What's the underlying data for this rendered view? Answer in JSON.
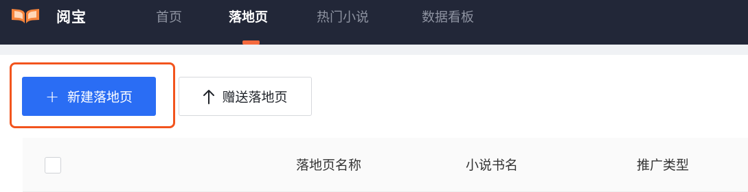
{
  "header": {
    "brand": "阅宝",
    "nav": [
      {
        "label": "首页",
        "active": false
      },
      {
        "label": "落地页",
        "active": true
      },
      {
        "label": "热门小说",
        "active": false
      },
      {
        "label": "数据看板",
        "active": false
      }
    ],
    "colors": {
      "bar": "#222738",
      "indicator": "#f56a3e"
    }
  },
  "toolbar": {
    "new_button_icon": "+",
    "new_button_label": "新建落地页",
    "gift_button_icon": "arrow-up-icon",
    "gift_button_label": "赠送落地页"
  },
  "table": {
    "columns": [
      "落地页名称",
      "小说书名",
      "推广类型"
    ]
  }
}
